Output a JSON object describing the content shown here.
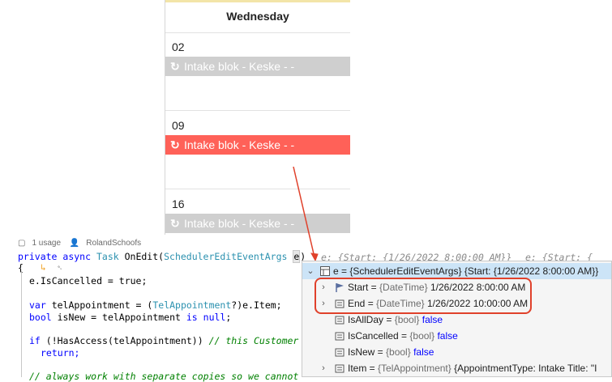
{
  "calendar": {
    "day_header": "Wednesday",
    "days": [
      {
        "date": "02",
        "event": "Intake blok - Keske - -",
        "color": "gray"
      },
      {
        "date": "09",
        "event": "Intake blok - Keske - -",
        "color": "red"
      },
      {
        "date": "16",
        "event": "Intake blok - Keske - -",
        "color": "gray"
      }
    ]
  },
  "codelens": {
    "usages": "1 usage",
    "author": "RolandSchoofs"
  },
  "code": {
    "signature": {
      "kw1": "private",
      "kw2": "async",
      "ret": "Task",
      "method": "OnEdit",
      "ptype": "SchedulerEditEventArgs",
      "pname": "e"
    },
    "hint1": "e: {Start: {1/26/2022 8:00:00 AM}}",
    "hint2": "e: {Start: {",
    "brace": "{",
    "line_cancel": "e.IsCancelled = true;",
    "line_var": "var telAppointment = (TelAppointment?)e.Item;",
    "line_isnew": "bool isNew = telAppointment is null;",
    "line_if": "if (!HasAccess(telAppointment))",
    "line_if_comment": "// this Customer",
    "line_return": "return;",
    "line_comment_cut": "// always work with separate copies so we cannot"
  },
  "datatip": {
    "header": {
      "name": "e",
      "type": "{SchedulerEditEventArgs}",
      "value": "{Start: {1/26/2022 8:00:00 AM}}"
    },
    "rows": [
      {
        "name": "Start",
        "type": "{DateTime}",
        "value": "1/26/2022 8:00:00 AM",
        "expandable": true
      },
      {
        "name": "End",
        "type": "{DateTime}",
        "value": "1/26/2022 10:00:00 AM",
        "expandable": true
      },
      {
        "name": "IsAllDay",
        "type": "{bool}",
        "value": "false",
        "expandable": false
      },
      {
        "name": "IsCancelled",
        "type": "{bool}",
        "value": "false",
        "expandable": false
      },
      {
        "name": "IsNew",
        "type": "{bool}",
        "value": "false",
        "expandable": false
      },
      {
        "name": "Item",
        "type": "{TelAppointment}",
        "value": "{AppointmentType: Intake  Title: \"I",
        "expandable": true
      }
    ]
  },
  "colors": {
    "accent_red": "#e0412b",
    "event_red": "#ff6158",
    "event_gray": "#cfcfcf",
    "selection": "#cce4f7"
  }
}
